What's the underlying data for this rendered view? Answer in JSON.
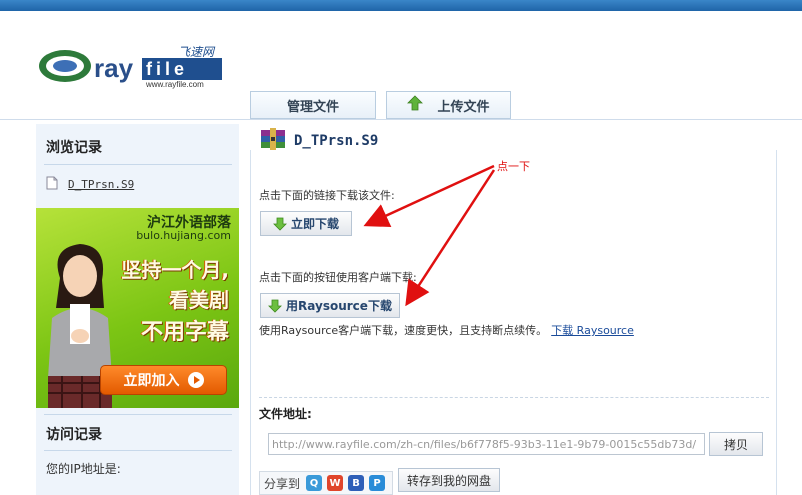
{
  "brand": {
    "logo_text": "rayfile",
    "logo_cn": "飞速网",
    "logo_url": "www.rayfile.com"
  },
  "tabs": [
    {
      "label": "管理文件"
    },
    {
      "label": "上传文件"
    }
  ],
  "sidebar": {
    "history_title": "浏览记录",
    "history_items": [
      {
        "label": "D_TPrsn.S9"
      }
    ],
    "visit_title": "访问记录",
    "ip_label": "您的IP地址是:"
  },
  "ad": {
    "brand": "沪江外语部落",
    "url": "bulo.hujiang.com",
    "line1": "坚持一个月,",
    "line2": "看美剧",
    "line3": "不用字幕",
    "button": "立即加入"
  },
  "file": {
    "name": "D_TPrsn.S9",
    "link_hint": "点击下面的链接下载该文件:",
    "download_now": "立即下载",
    "client_hint": "点击下面的按钮使用客户端下载:",
    "download_rs": "用Raysource下载",
    "rs_desc": "使用Raysource客户端下载，速度更快，且支持断点续传。",
    "rs_link": "下载 Raysource",
    "address_label": "文件地址:",
    "address_value": "http://www.rayfile.com/zh-cn/files/b6f778f5-93b3-11e1-9b79-0015c55db73d/",
    "copy_button": "拷贝",
    "share_label": "分享到",
    "save_button": "转存到我的网盘"
  },
  "annotation": {
    "text": "点一下",
    "color": "#e01010"
  },
  "colors": {
    "topbar": "#2a74b8",
    "sidebar_bg": "#eef4fb",
    "link": "#1a4b9a"
  },
  "icons": [
    "rar-archive-icon",
    "upload-arrow-icon",
    "download-arrow-icon",
    "document-icon",
    "play-icon"
  ]
}
